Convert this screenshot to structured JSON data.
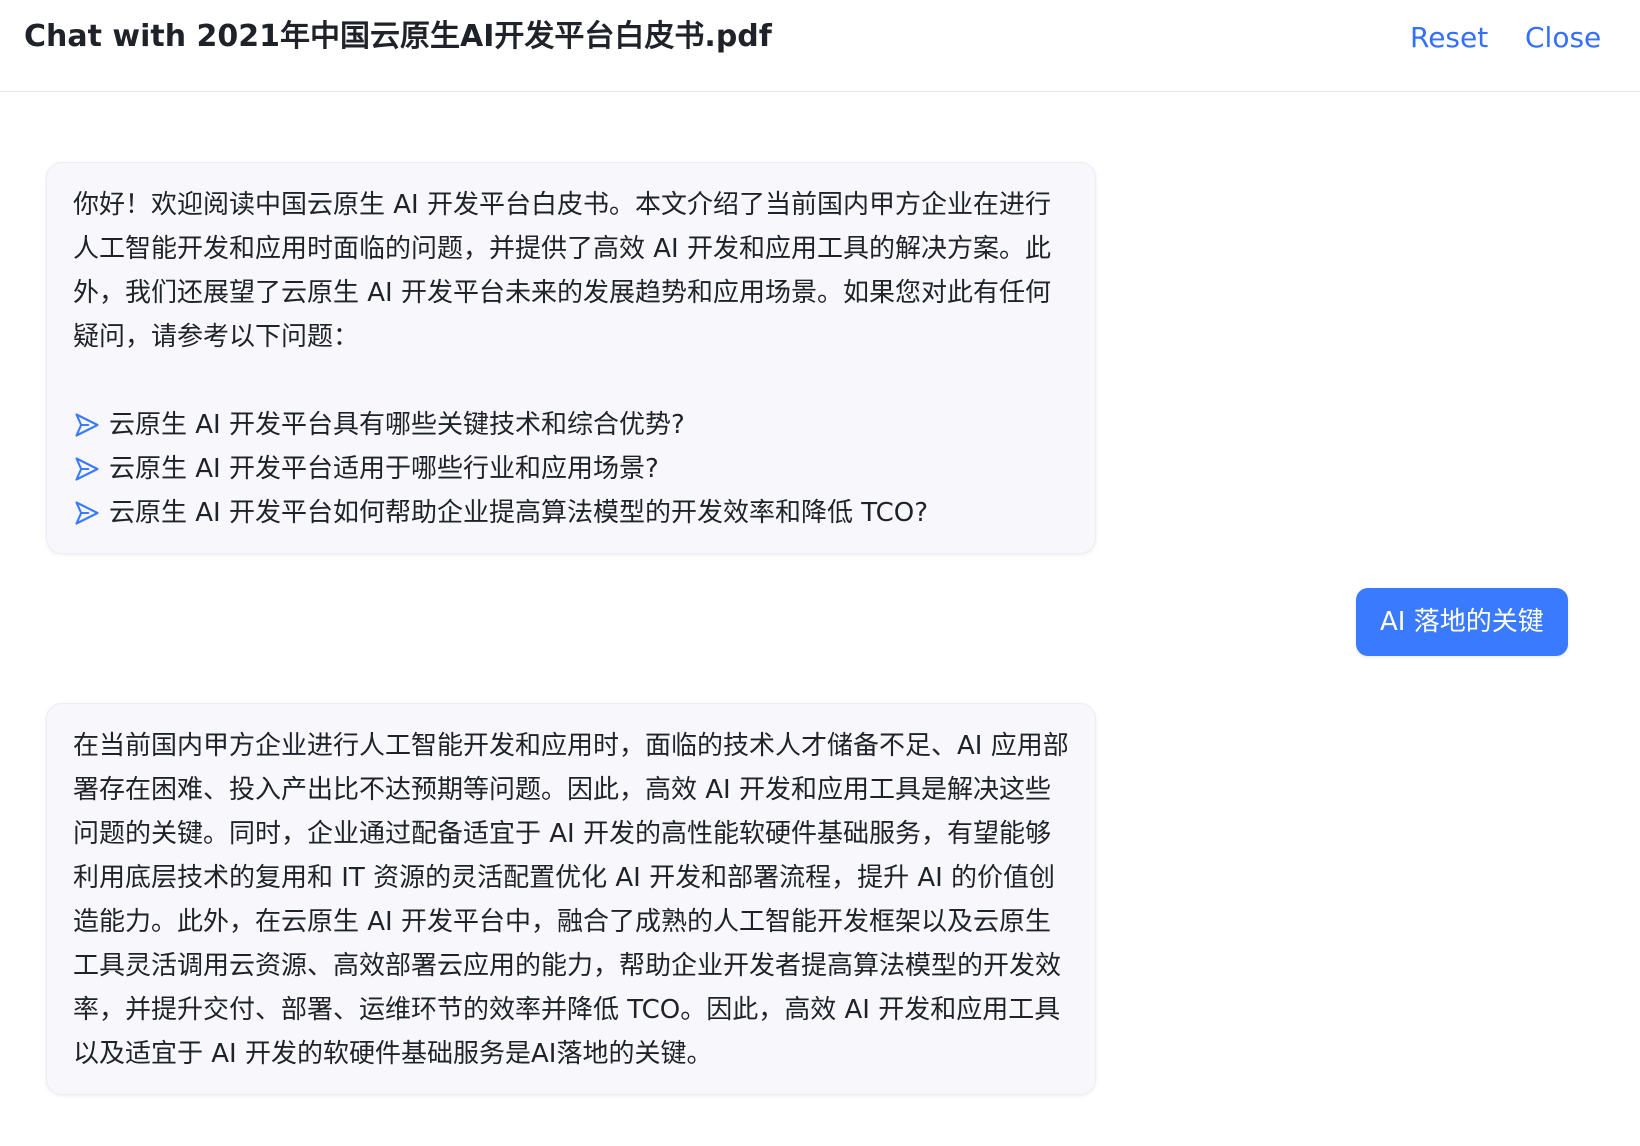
{
  "header": {
    "title": "Chat with 2021年中国云原生AI开发平台白皮书.pdf",
    "reset_label": "Reset",
    "close_label": "Close"
  },
  "colors": {
    "accent": "#3a7afe",
    "link": "#3370ff",
    "bubble_bg": "#f8f8fc"
  },
  "messages": [
    {
      "role": "assistant",
      "text": "你好！欢迎阅读中国云原生 AI 开发平台白皮书。本文介绍了当前国内甲方企业在进行人工智能开发和应用时面临的问题，并提供了高效 AI 开发和应用工具的解决方案。此外，我们还展望了云原生 AI 开发平台未来的发展趋势和应用场景。如果您对此有任何疑问，请参考以下问题：",
      "suggestion_icon": "send-arrow-icon",
      "suggestions": [
        "云原生 AI 开发平台具有哪些关键技术和综合优势?",
        "云原生 AI 开发平台适用于哪些行业和应用场景?",
        "云原生 AI 开发平台如何帮助企业提高算法模型的开发效率和降低 TCO?"
      ]
    },
    {
      "role": "user",
      "text": "AI 落地的关键"
    },
    {
      "role": "assistant",
      "text": "在当前国内甲方企业进行人工智能开发和应用时，面临的技术人才储备不足、AI 应用部署存在困难、投入产出比不达预期等问题。因此，高效 AI 开发和应用工具是解决这些问题的关键。同时，企业通过配备适宜于 AI 开发的高性能软硬件基础服务，有望能够利用底层技术的复用和 IT 资源的灵活配置优化 AI 开发和部署流程，提升 AI 的价值创造能力。此外，在云原生 AI 开发平台中，融合了成熟的人工智能开发框架以及云原生工具灵活调用云资源、高效部署云应用的能力，帮助企业开发者提高算法模型的开发效率，并提升交付、部署、运维环节的效率并降低 TCO。因此，高效 AI 开发和应用工具以及适宜于 AI 开发的软硬件基础服务是AI落地的关键。"
    }
  ]
}
